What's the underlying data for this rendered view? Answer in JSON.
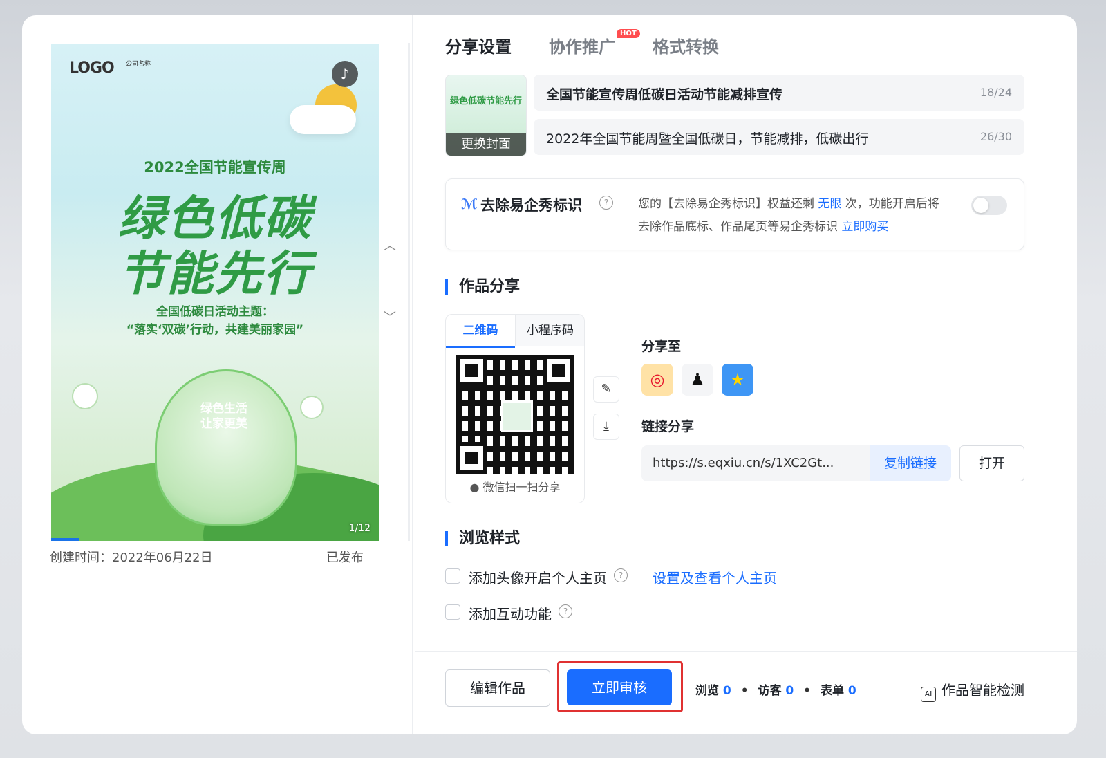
{
  "preview": {
    "poster": {
      "logo": "LOGO",
      "logo_sub": "公司名称",
      "subtitle": "2022全国节能宣传周",
      "headline1": "绿色低碳",
      "headline2": "节能先行",
      "theme_line1": "全国低碳日活动主题：",
      "theme_line2": "“落实‘双碳’行动，共建美丽家园”",
      "bulb_text1": "绿色生活",
      "bulb_text2": "让家更美",
      "page_indicator": "1/12"
    },
    "created_label": "创建时间：2022年06月22日",
    "status": "已发布"
  },
  "tabs": {
    "share": "分享设置",
    "coop": "协作推广",
    "hot": "HOT",
    "format": "格式转换"
  },
  "cover": {
    "change_label": "更换封面",
    "thumb_text": "绿色低碳节能先行"
  },
  "fields": {
    "title_value": "全国节能宣传周低碳日活动节能减排宣传",
    "title_count": "18/24",
    "desc_value": "2022年全国节能周暨全国低碳日，节能减排，低碳出行",
    "desc_count": "26/30"
  },
  "logo_removal": {
    "title": "去除易企秀标识",
    "desc_prefix": "您的【去除易企秀标识】权益还剩",
    "remaining": "无限",
    "desc_mid": "次，功能开启后将去除作品底标、作品尾页等易企秀标识",
    "buy_link": "立即购买"
  },
  "work_share": {
    "section_title": "作品分享",
    "qr_tab": "二维码",
    "mini_tab": "小程序码",
    "qr_caption": "微信扫一扫分享",
    "share_to_label": "分享至",
    "link_label": "链接分享",
    "link_url": "https://s.eqxiu.cn/s/1XC2Gt...",
    "copy_button": "复制链接",
    "open_button": "打开"
  },
  "browse": {
    "section_title": "浏览样式",
    "avatar_option": "添加头像开启个人主页",
    "homepage_link": "设置及查看个人主页",
    "interaction_option": "添加互动功能"
  },
  "footer": {
    "edit_button": "编辑作品",
    "review_button": "立即审核",
    "views_label": "浏览",
    "views": "0",
    "visitors_label": "访客",
    "visitors": "0",
    "forms_label": "表单",
    "forms": "0",
    "smart_check": "作品智能检测"
  },
  "colors": {
    "accent": "#1a6dff",
    "highlight": "#e03131",
    "hot": "#ff4d4f"
  }
}
